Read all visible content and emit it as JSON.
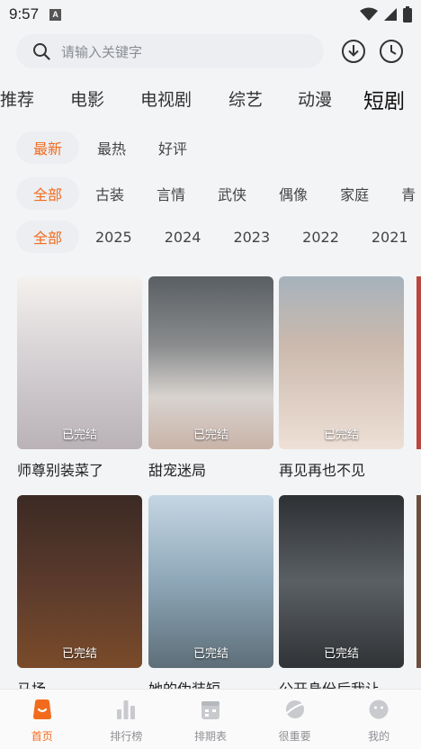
{
  "status_bar": {
    "time": "9:57",
    "indicator": "A"
  },
  "search": {
    "placeholder": "请输入关键字"
  },
  "category_tabs": [
    {
      "label": "推荐"
    },
    {
      "label": "电影"
    },
    {
      "label": "电视剧"
    },
    {
      "label": "综艺"
    },
    {
      "label": "动漫"
    },
    {
      "label": "短剧",
      "active": true
    }
  ],
  "sort_filters": [
    {
      "label": "最新",
      "active": true
    },
    {
      "label": "最热"
    },
    {
      "label": "好评"
    }
  ],
  "genre_filters": [
    {
      "label": "全部",
      "active": true
    },
    {
      "label": "古装"
    },
    {
      "label": "言情"
    },
    {
      "label": "武侠"
    },
    {
      "label": "偶像"
    },
    {
      "label": "家庭"
    },
    {
      "label": "青"
    }
  ],
  "year_filters": [
    {
      "label": "全部",
      "active": true
    },
    {
      "label": "2025"
    },
    {
      "label": "2024"
    },
    {
      "label": "2023"
    },
    {
      "label": "2022"
    },
    {
      "label": "2021"
    }
  ],
  "videos": [
    {
      "title": "师尊别装菜了",
      "badge": "已完结"
    },
    {
      "title": "甜宠迷局",
      "badge": "已完结"
    },
    {
      "title": "再见再也不见",
      "badge": "已完结"
    },
    {
      "title": "马场",
      "badge": "已完结"
    },
    {
      "title": "她的伪装短",
      "badge": "已完结"
    },
    {
      "title": "公开身份后我让",
      "badge": "已完结"
    }
  ],
  "bottom_nav": [
    {
      "label": "首页",
      "icon": "home-icon",
      "active": true
    },
    {
      "label": "排行榜",
      "icon": "ranking-icon"
    },
    {
      "label": "排期表",
      "icon": "schedule-icon"
    },
    {
      "label": "很重要",
      "icon": "planet-icon"
    },
    {
      "label": "我的",
      "icon": "profile-icon"
    }
  ],
  "colors": {
    "accent": "#f26b1d",
    "chip_bg": "#eceef1",
    "background": "#f3f4f6"
  }
}
